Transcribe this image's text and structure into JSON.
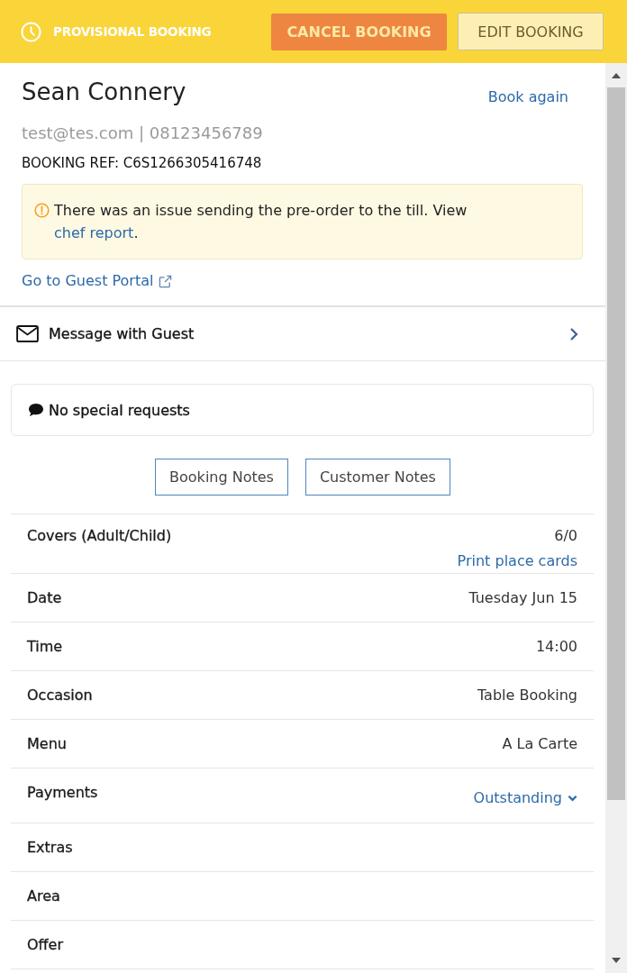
{
  "header": {
    "status": "PROVISIONAL BOOKING",
    "buttons": [
      {
        "label": "CANCEL BOOKING",
        "kind": "danger"
      },
      {
        "label": "EDIT BOOKING",
        "kind": "secondary"
      }
    ]
  },
  "guest": {
    "name": "Sean Connery",
    "book_again": "Book again",
    "contact": "test@tes.com | 08123456789",
    "booking_ref": "BOOKING REF: C6S1266305416748"
  },
  "alert": {
    "text": "There was an issue sending the pre-order to the till. View ",
    "link": "chef report",
    "end": "."
  },
  "guest_portal": "Go to Guest Portal",
  "message": "Message with Guest",
  "special_requests": "No special requests",
  "note_buttons": [
    "Booking Notes",
    "Customer Notes"
  ],
  "details": [
    {
      "kind": "value",
      "label": "Covers (Adult/Child)",
      "value": "6/0",
      "link": "Print place cards"
    },
    {
      "kind": "value",
      "label": "Date",
      "value": "Tuesday Jun 15"
    },
    {
      "kind": "value",
      "label": "Time",
      "value": "14:00"
    },
    {
      "kind": "value",
      "label": "Occasion",
      "value": "Table Booking"
    },
    {
      "kind": "value",
      "label": "Menu",
      "value": "A La Carte"
    },
    {
      "kind": "dropdown",
      "label": "Payments",
      "value": "Outstanding"
    },
    {
      "kind": "value",
      "label": "Extras"
    },
    {
      "kind": "value",
      "label": "Area"
    },
    {
      "kind": "value",
      "label": "Offer"
    }
  ]
}
